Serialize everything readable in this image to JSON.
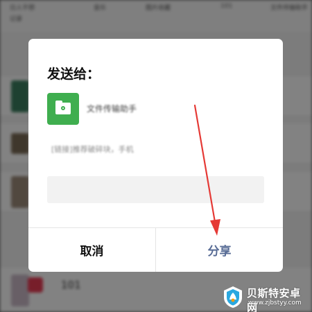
{
  "colors": {
    "dialog_bg": "#ffffff",
    "share_text": "#576b95",
    "recipient_icon": "#3fae4f",
    "annotation_arrow": "#e53935",
    "overlay": "rgba(0,0,0,0.48)"
  },
  "background_app": {
    "tabs": [
      {
        "line1": "日人不想",
        "line2": "记录"
      },
      {
        "line1": "音乐"
      },
      {
        "line1": "图片收藏"
      },
      {
        "line1": "101"
      },
      {
        "line1": "文件传输助手"
      }
    ],
    "rows": [
      {
        "text": ""
      },
      {
        "text": ""
      },
      {
        "text": ""
      },
      {
        "text": "101"
      }
    ]
  },
  "dialog": {
    "title": "发送给：",
    "recipient": {
      "name": "文件传输助手",
      "icon": "folder-icon"
    },
    "message_preview": "[链接]推荐破碎块，手机",
    "message_input_placeholder": "",
    "cancel_label": "取消",
    "share_label": "分享"
  },
  "watermark": {
    "title": "贝斯特安卓网",
    "url": "www.zjbstyy.com"
  }
}
